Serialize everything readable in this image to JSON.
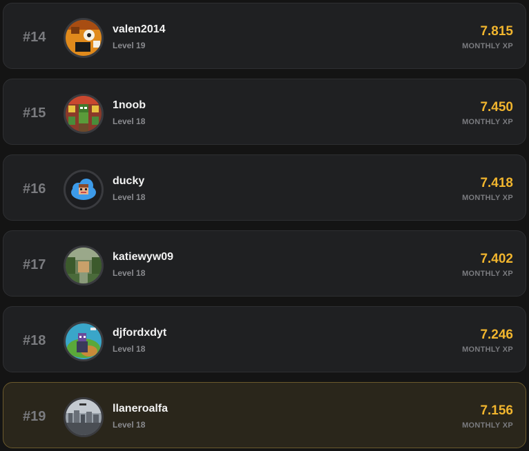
{
  "accent_color": "#f1b52e",
  "entries": [
    {
      "rank": "#14",
      "username": "valen2014",
      "level": "Level 19",
      "xp": "7.815",
      "xp_label": "MONTHLY XP",
      "avatar": "orange-character-avatar"
    },
    {
      "rank": "#15",
      "username": "1noob",
      "level": "Level 18",
      "xp": "7.450",
      "xp_label": "MONTHLY XP",
      "avatar": "minecraft-market-avatar"
    },
    {
      "rank": "#16",
      "username": "ducky",
      "level": "Level 18",
      "xp": "7.418",
      "xp_label": "MONTHLY XP",
      "avatar": "cloud-character-avatar"
    },
    {
      "rank": "#17",
      "username": "katiewyw09",
      "level": "Level 18",
      "xp": "7.402",
      "xp_label": "MONTHLY XP",
      "avatar": "forest-landscape-avatar"
    },
    {
      "rank": "#18",
      "username": "djfordxdyt",
      "level": "Level 18",
      "xp": "7.246",
      "xp_label": "MONTHLY XP",
      "avatar": "minecraft-island-avatar"
    },
    {
      "rank": "#19",
      "username": "llaneroalfa",
      "level": "Level 18",
      "xp": "7.156",
      "xp_label": "MONTHLY XP",
      "avatar": "city-skyline-avatar",
      "highlighted": true
    }
  ]
}
